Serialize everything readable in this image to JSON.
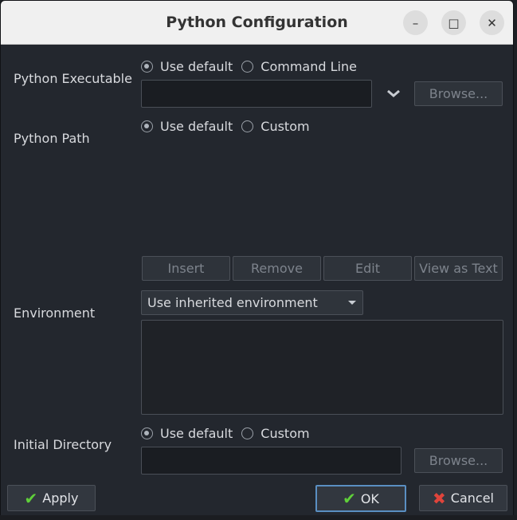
{
  "window": {
    "title": "Python Configuration"
  },
  "title_buttons": {
    "minimize": "–",
    "maximize": "□",
    "close": "✕"
  },
  "python_executable": {
    "label": "Python Executable",
    "option_default": "Use default",
    "option_alt": "Command Line",
    "selected": "default",
    "value": "",
    "browse_label": "Browse..."
  },
  "python_path": {
    "label": "Python Path",
    "option_default": "Use default",
    "option_alt": "Custom",
    "selected": "default",
    "buttons": {
      "insert": "Insert",
      "remove": "Remove",
      "edit": "Edit",
      "view_as_text": "View as Text"
    }
  },
  "environment": {
    "label": "Environment",
    "selected_option": "Use inherited environment"
  },
  "initial_directory": {
    "label": "Initial Directory",
    "option_default": "Use default",
    "option_alt": "Custom",
    "selected": "default",
    "value": "",
    "browse_label": "Browse..."
  },
  "footer": {
    "apply": "Apply",
    "ok": "OK",
    "cancel": "Cancel"
  },
  "colors": {
    "check": "#5fcf3a",
    "cancel_x": "#e0443b",
    "ok_border": "#5a8fc2"
  }
}
